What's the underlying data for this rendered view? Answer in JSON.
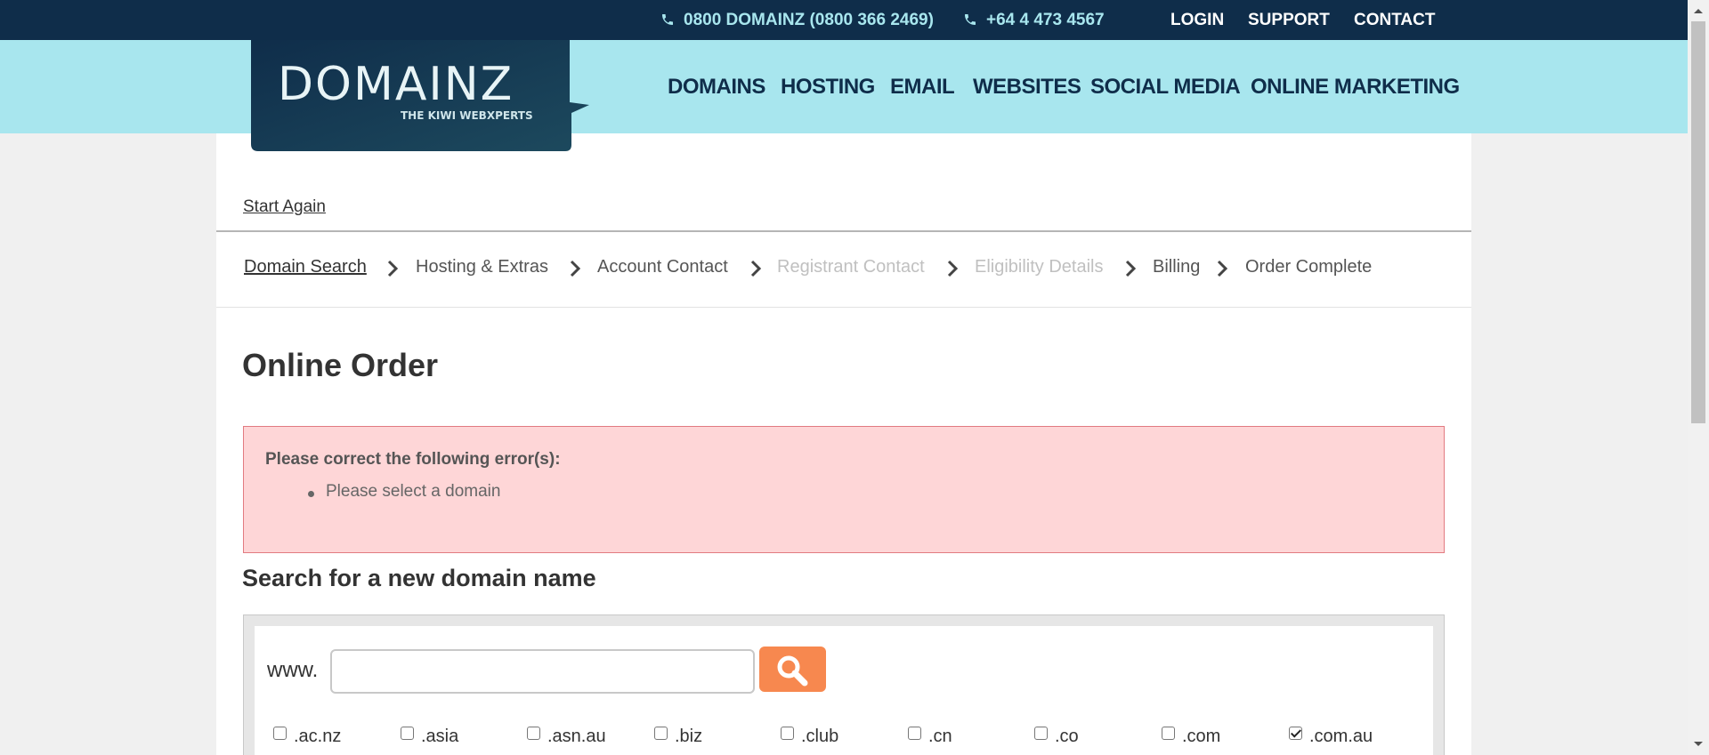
{
  "topbar": {
    "phone1": "0800 DOMAINZ (0800 366 2469)",
    "phone2": "+64 4 473 4567",
    "links": [
      "LOGIN",
      "SUPPORT",
      "CONTACT"
    ]
  },
  "logo": {
    "brand": "DOMAINZ",
    "tagline": "THE KIWI WEBXPERTS"
  },
  "nav": [
    "DOMAINS",
    "HOSTING",
    "EMAIL",
    "WEBSITES",
    "SOCIAL MEDIA",
    "ONLINE MARKETING"
  ],
  "start_again": "Start Again",
  "breadcrumb": {
    "steps": [
      {
        "label": "Domain Search",
        "state": "active"
      },
      {
        "label": "Hosting & Extras",
        "state": "normal"
      },
      {
        "label": "Account Contact",
        "state": "normal"
      },
      {
        "label": "Registrant Contact",
        "state": "disabled"
      },
      {
        "label": "Eligibility Details",
        "state": "disabled"
      },
      {
        "label": "Billing",
        "state": "normal"
      },
      {
        "label": "Order Complete",
        "state": "normal"
      }
    ]
  },
  "page_title": "Online Order",
  "error": {
    "title": "Please correct the following error(s):",
    "items": [
      "Please select a domain"
    ]
  },
  "search": {
    "title": "Search for a new domain name",
    "prefix": "www.",
    "value": "",
    "placeholder": ""
  },
  "tlds": [
    {
      "label": ".ac.nz",
      "checked": false
    },
    {
      "label": ".asia",
      "checked": false
    },
    {
      "label": ".asn.au",
      "checked": false
    },
    {
      "label": ".biz",
      "checked": false
    },
    {
      "label": ".club",
      "checked": false
    },
    {
      "label": ".cn",
      "checked": false
    },
    {
      "label": ".co",
      "checked": false
    },
    {
      "label": ".com",
      "checked": false
    },
    {
      "label": ".com.au",
      "checked": true
    }
  ],
  "colors": {
    "topbar": "#0f2d4a",
    "header": "#a8e6ee",
    "error_bg": "#fed6d7",
    "search_button": "#f7884f"
  },
  "icons": {
    "phone": "phone-icon",
    "search": "magnifier-icon",
    "chevron": "chevron-right-icon"
  }
}
